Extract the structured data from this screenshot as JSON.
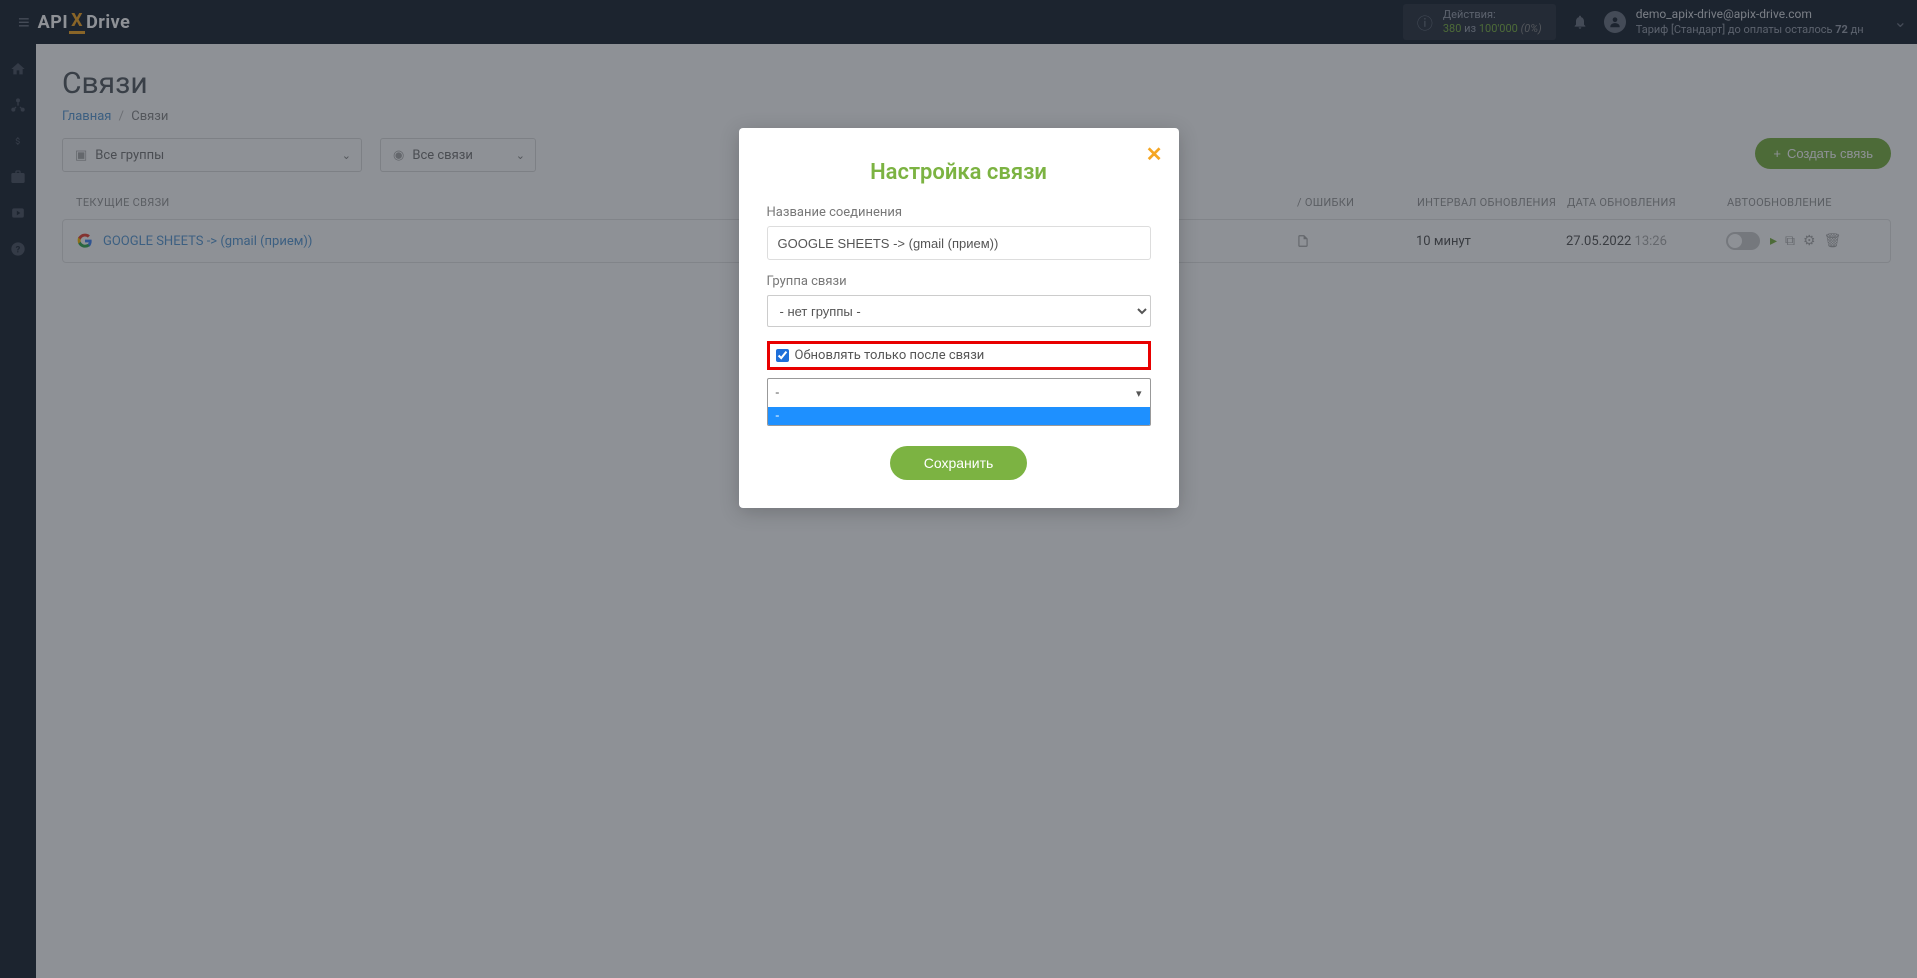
{
  "header": {
    "logo_api": "API",
    "logo_x": "X",
    "logo_drive": "Drive",
    "actions_label": "Действия:",
    "actions_used": "380",
    "actions_of": "из",
    "actions_total": "100'000",
    "actions_pct": "(0%)",
    "user_email": "demo_apix-drive@apix-drive.com",
    "plan_prefix": "Тариф [Стандарт] до оплаты осталось ",
    "plan_days": "72",
    "plan_suffix": " дн"
  },
  "page": {
    "title": "Связи",
    "breadcrumb_home": "Главная",
    "breadcrumb_current": "Связи"
  },
  "filters": {
    "groups": "Все группы",
    "connections": "Все связи",
    "create_label": "Создать связь"
  },
  "table": {
    "th_connections": "ТЕКУЩИЕ СВЯЗИ",
    "th_errors": "/ ОШИБКИ",
    "th_interval": "ИНТЕРВАЛ ОБНОВЛЕНИЯ",
    "th_date": "ДАТА ОБНОВЛЕНИЯ",
    "th_auto": "АВТООБНОВЛЕНИЕ",
    "row": {
      "name": "GOOGLE SHEETS -> (gmail (прием))",
      "interval": "10 минут",
      "date": "27.05.2022",
      "time": "13:26"
    }
  },
  "modal": {
    "title": "Настройка связи",
    "name_label": "Название соединения",
    "name_value": "GOOGLE SHEETS -> (gmail (прием))",
    "group_label": "Группа связи",
    "group_value": "- нет группы -",
    "checkbox_label": "Обновлять только после связи",
    "select2_value": "-",
    "select2_opt": "-",
    "save": "Сохранить"
  }
}
